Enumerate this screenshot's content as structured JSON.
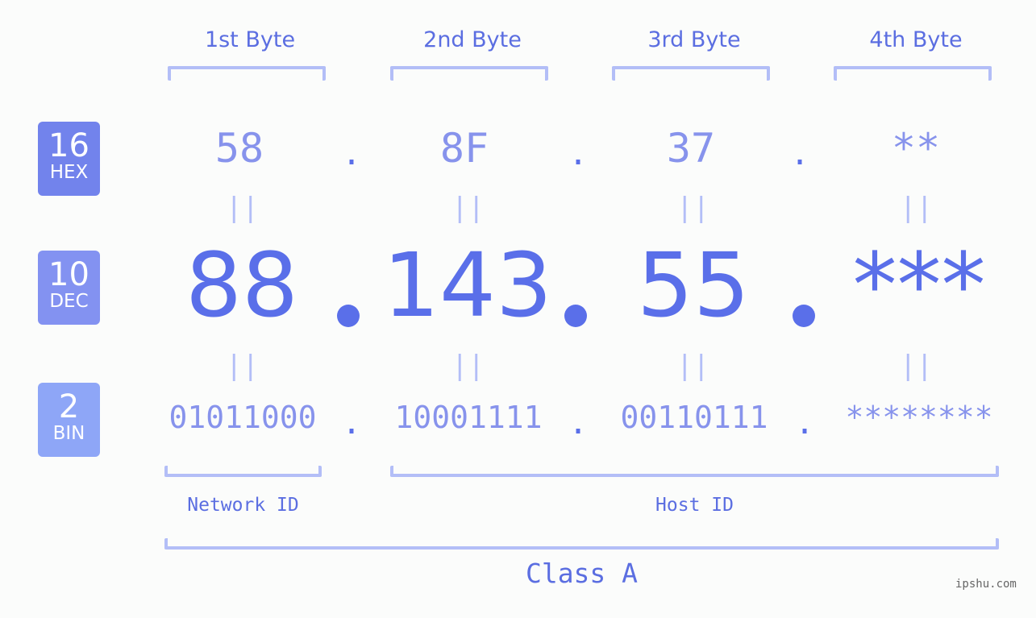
{
  "byte_headers": [
    "1st Byte",
    "2nd Byte",
    "3rd Byte",
    "4th Byte"
  ],
  "badges": [
    {
      "num": "16",
      "txt": "HEX",
      "color": "#7283ec"
    },
    {
      "num": "10",
      "txt": "DEC",
      "color": "#8392f1"
    },
    {
      "num": "2",
      "txt": "BIN",
      "color": "#8ea6f7"
    }
  ],
  "hex": [
    "58",
    "8F",
    "37",
    "**"
  ],
  "dec": [
    "88",
    "143",
    "55",
    "***"
  ],
  "bin": [
    "01011000",
    "10001111",
    "00110111",
    "********"
  ],
  "separator": ".",
  "equals": "=",
  "network_id_label": "Network ID",
  "host_id_label": "Host ID",
  "class_label": "Class A",
  "watermark": "ipshu.com"
}
